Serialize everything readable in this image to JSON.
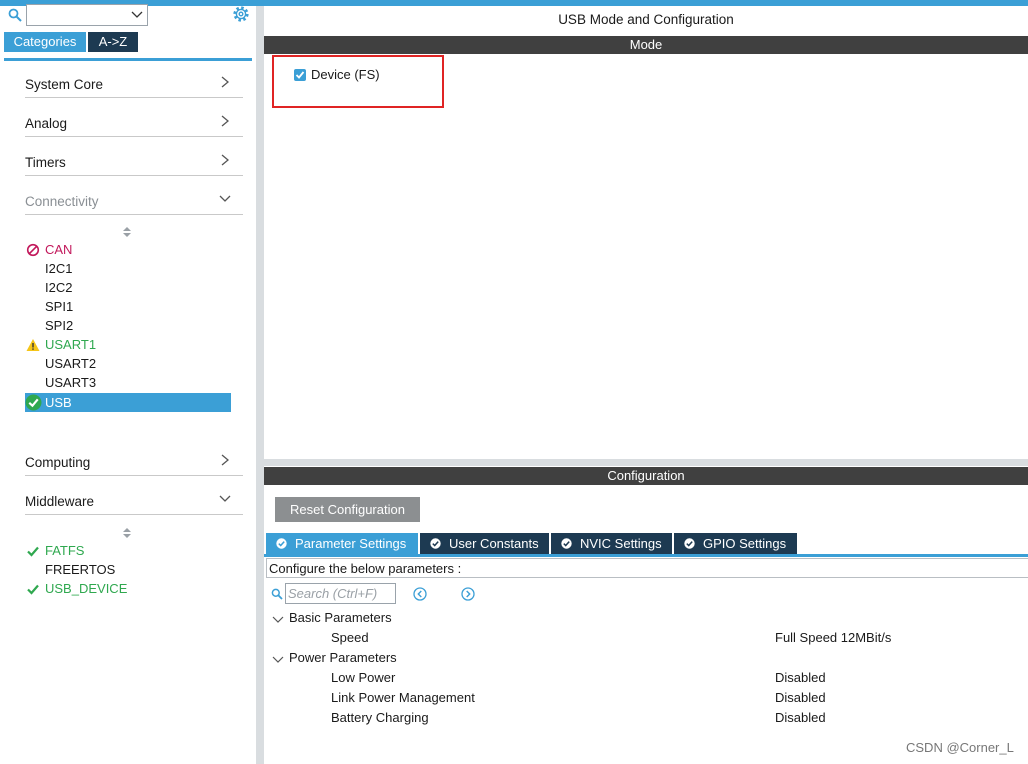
{
  "colors": {
    "accent": "#3b9fd6",
    "dark_tab": "#1d3a52",
    "header": "#404040",
    "error": "#c2185b",
    "ok": "#2fa84f",
    "warning": "#f5c518",
    "highlight_box": "#e02424"
  },
  "left": {
    "tabs": {
      "categories": "Categories",
      "az": "A->Z"
    },
    "categories": {
      "system_core": "System Core",
      "analog": "Analog",
      "timers": "Timers",
      "connectivity": "Connectivity",
      "computing": "Computing",
      "middleware": "Middleware"
    },
    "connectivity_items": [
      {
        "label": "CAN",
        "status": "error"
      },
      {
        "label": "I2C1",
        "status": "none"
      },
      {
        "label": "I2C2",
        "status": "none"
      },
      {
        "label": "SPI1",
        "status": "none"
      },
      {
        "label": "SPI2",
        "status": "none"
      },
      {
        "label": "USART1",
        "status": "warning"
      },
      {
        "label": "USART2",
        "status": "none"
      },
      {
        "label": "USART3",
        "status": "none"
      },
      {
        "label": "USB",
        "status": "ok-selected"
      }
    ],
    "middleware_items": [
      {
        "label": "FATFS",
        "status": "ok"
      },
      {
        "label": "FREERTOS",
        "status": "none"
      },
      {
        "label": "USB_DEVICE",
        "status": "ok"
      }
    ]
  },
  "right": {
    "title": "USB Mode and Configuration",
    "mode_header": "Mode",
    "mode_checkbox_label": "Device (FS)",
    "mode_checkbox_checked": true,
    "config_header": "Configuration",
    "reset_button": "Reset Configuration",
    "param_tabs": [
      "Parameter Settings",
      "User Constants",
      "NVIC Settings",
      "GPIO Settings"
    ],
    "info_text": "Configure the below parameters :",
    "search_placeholder": "Search (Ctrl+F)",
    "groups": [
      {
        "name": "Basic Parameters",
        "params": [
          {
            "name": "Speed",
            "value": "Full Speed 12MBit/s"
          }
        ]
      },
      {
        "name": "Power Parameters",
        "params": [
          {
            "name": "Low Power",
            "value": "Disabled"
          },
          {
            "name": "Link Power Management",
            "value": "Disabled"
          },
          {
            "name": "Battery Charging",
            "value": "Disabled"
          }
        ]
      }
    ]
  },
  "watermark": "CSDN @Corner_L"
}
